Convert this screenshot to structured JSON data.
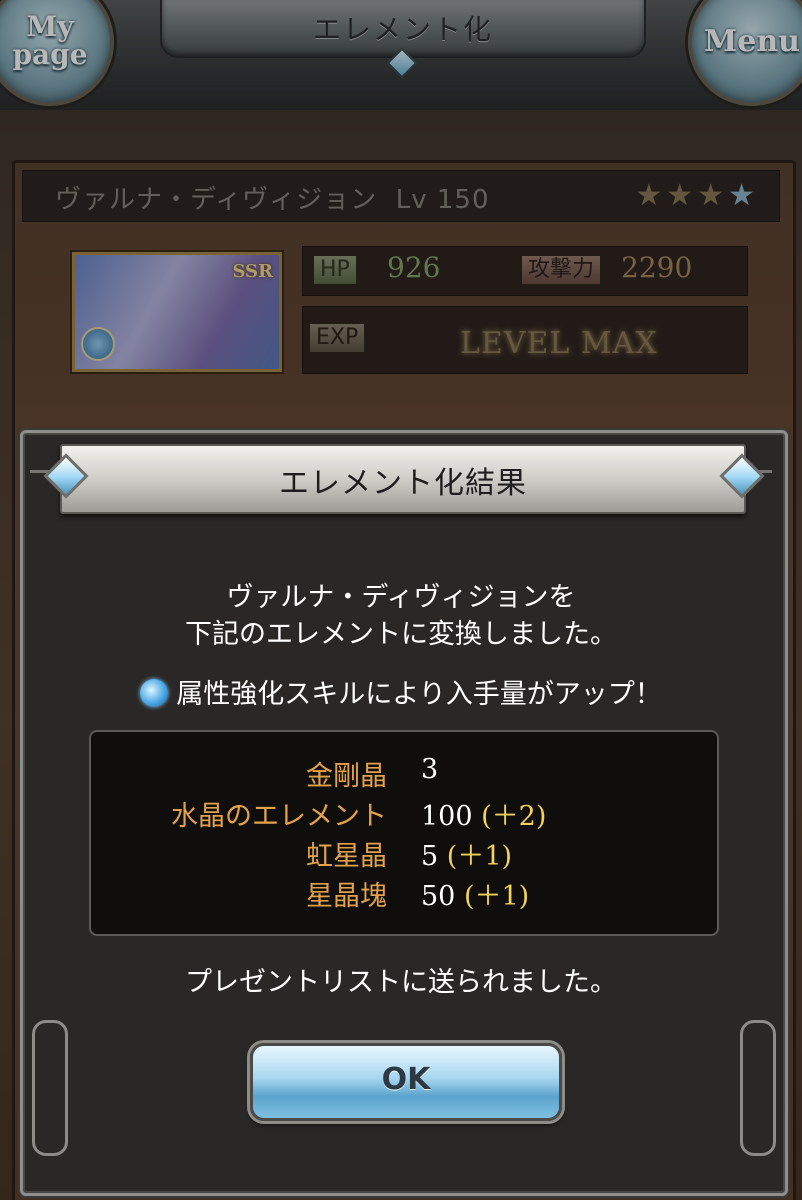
{
  "header": {
    "title": "エレメント化",
    "mypage_label_1": "My",
    "mypage_label_2": "page",
    "menu_label": "Menu"
  },
  "character": {
    "name": "ヴァルナ・ディヴィジョン",
    "level": "Lv 150",
    "rarity": "SSR",
    "stars_filled": 3,
    "stars_total": 4,
    "hp_label": "HP",
    "hp_value": "926",
    "atk_label": "攻撃力",
    "atk_value": "2290",
    "exp_label": "EXP",
    "exp_value": "LEVEL MAX"
  },
  "modal": {
    "title": "エレメント化結果",
    "message_line1": "ヴァルナ・ディヴィジョンを",
    "message_line2": "下記のエレメントに変換しました。",
    "skill_note": "属性強化スキルにより入手量がアップ！",
    "results": [
      {
        "name": "金剛晶",
        "amount": "3",
        "bonus": ""
      },
      {
        "name": "水晶のエレメント",
        "amount": "100",
        "bonus": "(＋2)"
      },
      {
        "name": "虹星晶",
        "amount": "5",
        "bonus": "(＋1)"
      },
      {
        "name": "星晶塊",
        "amount": "50",
        "bonus": "(＋1)"
      }
    ],
    "footer": "プレゼントリストに送られました。",
    "ok_label": "OK"
  },
  "colors": {
    "result_name": "#e3a24a",
    "result_bonus": "#f3d35a",
    "accent_blue": "#5ba3cd"
  }
}
